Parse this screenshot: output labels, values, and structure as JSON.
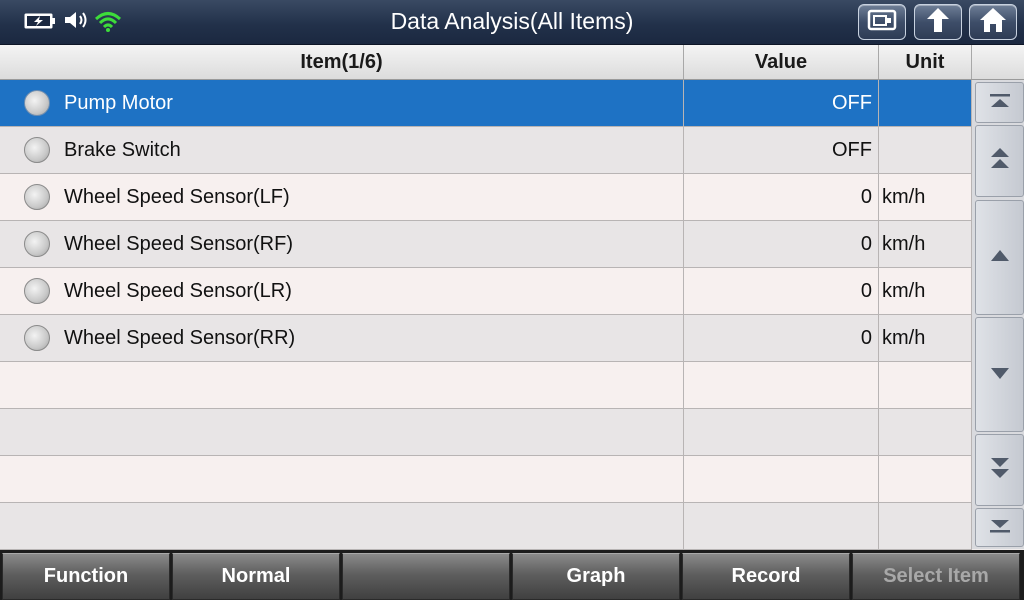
{
  "header": {
    "title": "Data Analysis(All Items)",
    "icons": [
      "battery-charging-icon",
      "speaker-icon",
      "wifi-icon",
      "report-icon",
      "back-arrow-icon",
      "home-icon"
    ]
  },
  "table": {
    "headers": {
      "item": "Item(1/6)",
      "value": "Value",
      "unit": "Unit"
    },
    "rows": [
      {
        "item": "Pump Motor",
        "value": "OFF",
        "unit": ""
      },
      {
        "item": "Brake Switch",
        "value": "OFF",
        "unit": ""
      },
      {
        "item": "Wheel Speed Sensor(LF)",
        "value": "0",
        "unit": "km/h"
      },
      {
        "item": "Wheel Speed Sensor(RF)",
        "value": "0",
        "unit": "km/h"
      },
      {
        "item": "Wheel Speed Sensor(LR)",
        "value": "0",
        "unit": "km/h"
      },
      {
        "item": "Wheel Speed Sensor(RR)",
        "value": "0",
        "unit": "km/h"
      }
    ],
    "selected_index": 0
  },
  "scroll": {
    "buttons": [
      "scroll-first-icon",
      "scroll-page-up-icon",
      "scroll-up-icon",
      "scroll-down-icon",
      "scroll-page-down-icon",
      "scroll-last-icon"
    ]
  },
  "toolbar": {
    "function_label": "Function",
    "normal_label": "Normal",
    "blank_label": "",
    "graph_label": "Graph",
    "record_label": "Record",
    "select_item_label": "Select Item"
  },
  "colors": {
    "header_bg": "#22314a",
    "selected_row": "#1e72c4",
    "row_odd": "#f7f0ef",
    "row_even": "#e8e5e6",
    "wifi_green": "#3ddc3a"
  }
}
